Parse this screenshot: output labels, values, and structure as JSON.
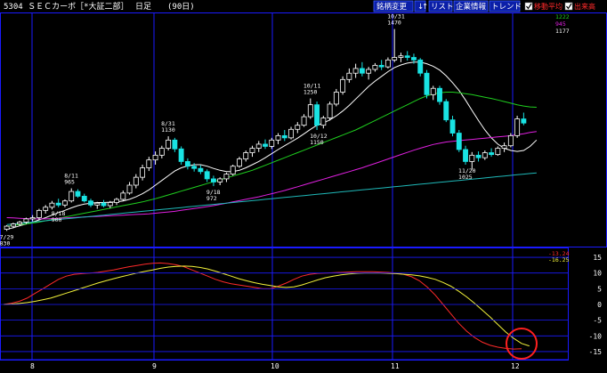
{
  "header": {
    "title": "5304 ＳＥＣカーボ［*大証二部］",
    "period": "日足",
    "days": "(90日)",
    "buttons": [
      "銘柄変更",
      "↓",
      "↑",
      "リスト",
      "企業情報",
      "トレンド"
    ],
    "checkboxes": [
      "移動平均",
      "出来高"
    ]
  },
  "legend_values": [
    "1222",
    "945",
    "1177"
  ],
  "colors": {
    "background": "#000000",
    "frame": "#1a1aff",
    "candle": "#19e3e3",
    "ma_short": "#ffffff",
    "ma_mid": "#1fcf1f",
    "ma_long": "#e020e0",
    "ma_longest": "#1fb8b8",
    "osc_fast": "#ff2a2a",
    "osc_slow": "#f2f23a",
    "highlight_circle": "#ff2020"
  },
  "chart_data": [
    {
      "type": "candlestick",
      "title": "5304 ＳＥＣカーボ 日足 (90日)",
      "x_ticks": [
        "8",
        "9",
        "10",
        "11",
        "12"
      ],
      "annotations": [
        {
          "date": "7/29",
          "price": 830
        },
        {
          "date": "8/11",
          "price": 965
        },
        {
          "date": "8/18",
          "price": 900
        },
        {
          "date": "8/31",
          "price": 1130
        },
        {
          "date": "9/18",
          "price": 972
        },
        {
          "date": "10/11",
          "price": 1250
        },
        {
          "date": "10/12",
          "price": 1150
        },
        {
          "date": "10/31",
          "price": 1470
        },
        {
          "date": "11/20",
          "price": 1025
        }
      ],
      "ohlc": [
        {
          "o": 835,
          "h": 848,
          "l": 830,
          "c": 845
        },
        {
          "o": 845,
          "h": 856,
          "l": 838,
          "c": 852
        },
        {
          "o": 852,
          "h": 862,
          "l": 845,
          "c": 858
        },
        {
          "o": 858,
          "h": 872,
          "l": 852,
          "c": 868
        },
        {
          "o": 868,
          "h": 880,
          "l": 860,
          "c": 872
        },
        {
          "o": 872,
          "h": 900,
          "l": 865,
          "c": 895
        },
        {
          "o": 895,
          "h": 912,
          "l": 885,
          "c": 905
        },
        {
          "o": 905,
          "h": 925,
          "l": 898,
          "c": 918
        },
        {
          "o": 918,
          "h": 932,
          "l": 905,
          "c": 912
        },
        {
          "o": 912,
          "h": 930,
          "l": 905,
          "c": 925
        },
        {
          "o": 925,
          "h": 965,
          "l": 920,
          "c": 955
        },
        {
          "o": 955,
          "h": 962,
          "l": 935,
          "c": 940
        },
        {
          "o": 940,
          "h": 948,
          "l": 920,
          "c": 925
        },
        {
          "o": 925,
          "h": 932,
          "l": 905,
          "c": 912
        },
        {
          "o": 912,
          "h": 922,
          "l": 900,
          "c": 918
        },
        {
          "o": 918,
          "h": 928,
          "l": 905,
          "c": 910
        },
        {
          "o": 910,
          "h": 925,
          "l": 902,
          "c": 920
        },
        {
          "o": 920,
          "h": 935,
          "l": 912,
          "c": 930
        },
        {
          "o": 930,
          "h": 958,
          "l": 925,
          "c": 950
        },
        {
          "o": 950,
          "h": 985,
          "l": 945,
          "c": 975
        },
        {
          "o": 975,
          "h": 1010,
          "l": 965,
          "c": 1000
        },
        {
          "o": 1000,
          "h": 1040,
          "l": 990,
          "c": 1030
        },
        {
          "o": 1030,
          "h": 1065,
          "l": 1020,
          "c": 1055
        },
        {
          "o": 1055,
          "h": 1082,
          "l": 1040,
          "c": 1070
        },
        {
          "o": 1070,
          "h": 1100,
          "l": 1060,
          "c": 1092
        },
        {
          "o": 1092,
          "h": 1130,
          "l": 1085,
          "c": 1118
        },
        {
          "o": 1118,
          "h": 1125,
          "l": 1080,
          "c": 1090
        },
        {
          "o": 1090,
          "h": 1098,
          "l": 1040,
          "c": 1050
        },
        {
          "o": 1050,
          "h": 1060,
          "l": 1025,
          "c": 1035
        },
        {
          "o": 1035,
          "h": 1045,
          "l": 1018,
          "c": 1028
        },
        {
          "o": 1028,
          "h": 1038,
          "l": 1010,
          "c": 1018
        },
        {
          "o": 1018,
          "h": 1025,
          "l": 985,
          "c": 995
        },
        {
          "o": 995,
          "h": 1005,
          "l": 972,
          "c": 985
        },
        {
          "o": 985,
          "h": 1000,
          "l": 975,
          "c": 995
        },
        {
          "o": 995,
          "h": 1015,
          "l": 985,
          "c": 1010
        },
        {
          "o": 1010,
          "h": 1040,
          "l": 1005,
          "c": 1035
        },
        {
          "o": 1035,
          "h": 1065,
          "l": 1030,
          "c": 1058
        },
        {
          "o": 1058,
          "h": 1085,
          "l": 1050,
          "c": 1078
        },
        {
          "o": 1078,
          "h": 1100,
          "l": 1065,
          "c": 1092
        },
        {
          "o": 1092,
          "h": 1115,
          "l": 1080,
          "c": 1105
        },
        {
          "o": 1105,
          "h": 1120,
          "l": 1090,
          "c": 1098
        },
        {
          "o": 1098,
          "h": 1125,
          "l": 1090,
          "c": 1118
        },
        {
          "o": 1118,
          "h": 1140,
          "l": 1105,
          "c": 1132
        },
        {
          "o": 1132,
          "h": 1150,
          "l": 1115,
          "c": 1125
        },
        {
          "o": 1125,
          "h": 1160,
          "l": 1120,
          "c": 1152
        },
        {
          "o": 1152,
          "h": 1175,
          "l": 1140,
          "c": 1165
        },
        {
          "o": 1165,
          "h": 1200,
          "l": 1160,
          "c": 1192
        },
        {
          "o": 1192,
          "h": 1250,
          "l": 1185,
          "c": 1230
        },
        {
          "o": 1230,
          "h": 1240,
          "l": 1150,
          "c": 1165
        },
        {
          "o": 1165,
          "h": 1195,
          "l": 1155,
          "c": 1188
        },
        {
          "o": 1188,
          "h": 1240,
          "l": 1180,
          "c": 1232
        },
        {
          "o": 1232,
          "h": 1280,
          "l": 1225,
          "c": 1270
        },
        {
          "o": 1270,
          "h": 1320,
          "l": 1262,
          "c": 1310
        },
        {
          "o": 1310,
          "h": 1345,
          "l": 1300,
          "c": 1330
        },
        {
          "o": 1330,
          "h": 1360,
          "l": 1315,
          "c": 1345
        },
        {
          "o": 1345,
          "h": 1365,
          "l": 1320,
          "c": 1330
        },
        {
          "o": 1330,
          "h": 1350,
          "l": 1310,
          "c": 1342
        },
        {
          "o": 1342,
          "h": 1362,
          "l": 1335,
          "c": 1355
        },
        {
          "o": 1355,
          "h": 1372,
          "l": 1340,
          "c": 1350
        },
        {
          "o": 1350,
          "h": 1380,
          "l": 1345,
          "c": 1372
        },
        {
          "o": 1372,
          "h": 1470,
          "l": 1365,
          "c": 1380
        },
        {
          "o": 1380,
          "h": 1395,
          "l": 1365,
          "c": 1385
        },
        {
          "o": 1385,
          "h": 1400,
          "l": 1370,
          "c": 1380
        },
        {
          "o": 1380,
          "h": 1392,
          "l": 1360,
          "c": 1372
        },
        {
          "o": 1372,
          "h": 1378,
          "l": 1320,
          "c": 1330
        },
        {
          "o": 1330,
          "h": 1340,
          "l": 1250,
          "c": 1262
        },
        {
          "o": 1262,
          "h": 1290,
          "l": 1245,
          "c": 1282
        },
        {
          "o": 1282,
          "h": 1290,
          "l": 1230,
          "c": 1240
        },
        {
          "o": 1240,
          "h": 1248,
          "l": 1175,
          "c": 1182
        },
        {
          "o": 1182,
          "h": 1195,
          "l": 1130,
          "c": 1140
        },
        {
          "o": 1140,
          "h": 1150,
          "l": 1080,
          "c": 1088
        },
        {
          "o": 1088,
          "h": 1100,
          "l": 1040,
          "c": 1050
        },
        {
          "o": 1050,
          "h": 1080,
          "l": 1025,
          "c": 1070
        },
        {
          "o": 1070,
          "h": 1082,
          "l": 1050,
          "c": 1062
        },
        {
          "o": 1062,
          "h": 1085,
          "l": 1055,
          "c": 1078
        },
        {
          "o": 1078,
          "h": 1092,
          "l": 1065,
          "c": 1072
        },
        {
          "o": 1072,
          "h": 1098,
          "l": 1068,
          "c": 1092
        },
        {
          "o": 1092,
          "h": 1110,
          "l": 1080,
          "c": 1100
        },
        {
          "o": 1100,
          "h": 1140,
          "l": 1095,
          "c": 1132
        },
        {
          "o": 1132,
          "h": 1195,
          "l": 1125,
          "c": 1185
        },
        {
          "o": 1185,
          "h": 1205,
          "l": 1165,
          "c": 1172
        }
      ],
      "moving_averages": [
        {
          "name": "ma_short",
          "values": [
            835,
            840,
            846,
            852,
            858,
            865,
            872,
            880,
            888,
            895,
            903,
            910,
            915,
            918,
            920,
            920,
            921,
            922,
            925,
            930,
            938,
            948,
            960,
            975,
            990,
            1005,
            1020,
            1030,
            1036,
            1040,
            1040,
            1035,
            1028,
            1022,
            1018,
            1018,
            1022,
            1030,
            1040,
            1050,
            1062,
            1075,
            1088,
            1100,
            1112,
            1124,
            1138,
            1152,
            1165,
            1172,
            1182,
            1195,
            1210,
            1228,
            1248,
            1268,
            1288,
            1305,
            1320,
            1335,
            1348,
            1356,
            1362,
            1365,
            1365,
            1360,
            1352,
            1340,
            1322,
            1300,
            1275,
            1245,
            1212,
            1180,
            1150,
            1125,
            1105,
            1092,
            1085,
            1082,
            1085,
            1098,
            1118
          ]
        },
        {
          "name": "ma_mid",
          "values": [
            845,
            847,
            850,
            852,
            855,
            858,
            862,
            866,
            870,
            874,
            878,
            882,
            886,
            890,
            894,
            898,
            902,
            906,
            910,
            914,
            918,
            922,
            927,
            932,
            938,
            944,
            950,
            956,
            962,
            968,
            974,
            980,
            986,
            992,
            998,
            1004,
            1010,
            1016,
            1022,
            1030,
            1038,
            1046,
            1054,
            1062,
            1070,
            1078,
            1086,
            1094,
            1102,
            1110,
            1118,
            1126,
            1134,
            1142,
            1150,
            1160,
            1170,
            1180,
            1190,
            1200,
            1210,
            1220,
            1230,
            1240,
            1250,
            1258,
            1264,
            1268,
            1270,
            1270,
            1268,
            1265,
            1262,
            1258,
            1254,
            1250,
            1245,
            1240,
            1235,
            1230,
            1226,
            1223,
            1222
          ]
        },
        {
          "name": "ma_long",
          "values": [
            872,
            871,
            870,
            869,
            868,
            868,
            868,
            869,
            870,
            871,
            872,
            873,
            874,
            875,
            876,
            877,
            878,
            879,
            880,
            881,
            882,
            883,
            884,
            886,
            888,
            890,
            892,
            895,
            898,
            901,
            904,
            907,
            910,
            914,
            918,
            922,
            926,
            930,
            934,
            938,
            943,
            948,
            953,
            958,
            964,
            970,
            976,
            982,
            988,
            994,
            1000,
            1006,
            1012,
            1018,
            1024,
            1030,
            1037,
            1044,
            1051,
            1058,
            1065,
            1072,
            1079,
            1086,
            1092,
            1098,
            1104,
            1108,
            1112,
            1114,
            1116,
            1118,
            1120,
            1122,
            1124,
            1126,
            1128,
            1130,
            1132,
            1135,
            1138,
            1142,
            1145
          ]
        },
        {
          "name": "ma_longest",
          "values": [
            850,
            852,
            854,
            856,
            858,
            860,
            862,
            864,
            866,
            868,
            870,
            872,
            874,
            876,
            878,
            880,
            882,
            884,
            886,
            888,
            890,
            892,
            894,
            896,
            898,
            900,
            902,
            904,
            906,
            908,
            910,
            912,
            914,
            916,
            918,
            920,
            922,
            924,
            926,
            928,
            930,
            932,
            934,
            936,
            938,
            940,
            942,
            944,
            946,
            948,
            950,
            952,
            954,
            956,
            958,
            960,
            962,
            964,
            966,
            968,
            970,
            972,
            974,
            976,
            978,
            980,
            982,
            984,
            986,
            988,
            990,
            992,
            994,
            996,
            998,
            1000,
            1002,
            1004,
            1006,
            1008,
            1010,
            1012,
            1014
          ]
        }
      ],
      "ylim": [
        800,
        1500
      ]
    },
    {
      "type": "line",
      "x_ticks": [
        "8",
        "9",
        "10",
        "11",
        "12"
      ],
      "y_ticks": [
        15,
        10,
        5,
        0,
        -5,
        -10,
        -15
      ],
      "ylim": [
        -17,
        17
      ],
      "current_values": [
        "-13.24",
        "-16.25"
      ],
      "series": [
        {
          "name": "fast",
          "values": [
            0,
            0.4,
            1,
            2,
            3.5,
            5,
            6.5,
            8,
            9,
            9.6,
            9.8,
            10,
            10.2,
            10.6,
            11,
            11.5,
            12,
            12.4,
            12.8,
            13.1,
            13.2,
            13,
            12.6,
            12,
            11,
            10,
            9,
            8,
            7.2,
            6.6,
            6.2,
            5.8,
            5.4,
            5,
            5,
            5.8,
            6.8,
            8,
            9,
            9.6,
            9.9,
            10,
            10.1,
            10.2,
            10.3,
            10.4,
            10.4,
            10.4,
            10.3,
            10.2,
            10,
            9.6,
            8.8,
            7.5,
            5.5,
            3,
            0,
            -3,
            -6,
            -8.5,
            -10.5,
            -12,
            -13,
            -13.6,
            -14,
            -14.2,
            -14.1
          ]
        },
        {
          "name": "slow",
          "values": [
            0,
            0.1,
            0.3,
            0.6,
            1,
            1.5,
            2,
            2.8,
            3.6,
            4.4,
            5.2,
            6,
            6.8,
            7.5,
            8.2,
            8.8,
            9.4,
            10,
            10.5,
            11,
            11.5,
            11.9,
            12.1,
            12.2,
            12.1,
            11.8,
            11.3,
            10.6,
            9.8,
            9,
            8.2,
            7.5,
            6.9,
            6.4,
            6,
            5.6,
            5.4,
            5.6,
            6.2,
            7,
            7.8,
            8.5,
            9,
            9.4,
            9.7,
            9.9,
            10,
            10,
            10,
            9.9,
            9.8,
            9.6,
            9.4,
            9.1,
            8.6,
            8,
            7,
            5.8,
            4.2,
            2.4,
            0.4,
            -1.8,
            -4,
            -6.4,
            -8.8,
            -10.8,
            -12.4,
            -13.2
          ]
        }
      ]
    }
  ]
}
